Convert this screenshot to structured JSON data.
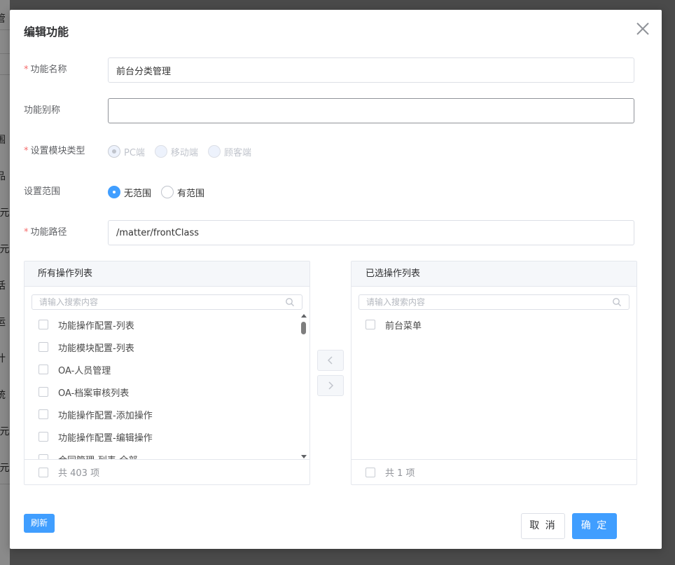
{
  "background": {
    "fragments": [
      "管",
      "围",
      "品",
      "(元",
      "(元",
      "话",
      "运",
      "计",
      "统",
      "(元",
      "(元"
    ]
  },
  "dialog": {
    "title": "编辑功能",
    "close_icon": "close-icon"
  },
  "form": {
    "function_name": {
      "label": "功能名称",
      "required": true,
      "value": "前台分类管理"
    },
    "function_alias": {
      "label": "功能别称",
      "required": false,
      "value": ""
    },
    "module_type": {
      "label": "设置模块类型",
      "required": true,
      "options": [
        "PC端",
        "移动端",
        "顾客端"
      ],
      "selected": "PC端",
      "disabled": true
    },
    "scope": {
      "label": "设置范围",
      "required": false,
      "options": [
        "无范围",
        "有范围"
      ],
      "selected": "无范围"
    },
    "function_path": {
      "label": "功能路径",
      "required": true,
      "value": "/matter/frontClass"
    }
  },
  "transfer": {
    "left": {
      "title": "所有操作列表",
      "search_placeholder": "请输入搜索内容",
      "items": [
        "功能操作配置-列表",
        "功能模块配置-列表",
        "OA-人员管理",
        "OA-档案审核列表",
        "功能操作配置-添加操作",
        "功能操作配置-编辑操作",
        "合同管理-列表-全部"
      ],
      "footer": "共 403 项"
    },
    "right": {
      "title": "已选操作列表",
      "search_placeholder": "请输入搜索内容",
      "items": [
        "前台菜单"
      ],
      "footer": "共 1 项"
    }
  },
  "buttons": {
    "refresh": "刷新",
    "cancel": "取 消",
    "confirm": "确 定"
  },
  "colors": {
    "primary": "#409eff",
    "required": "#f56c6c",
    "border": "#dcdfe6"
  }
}
